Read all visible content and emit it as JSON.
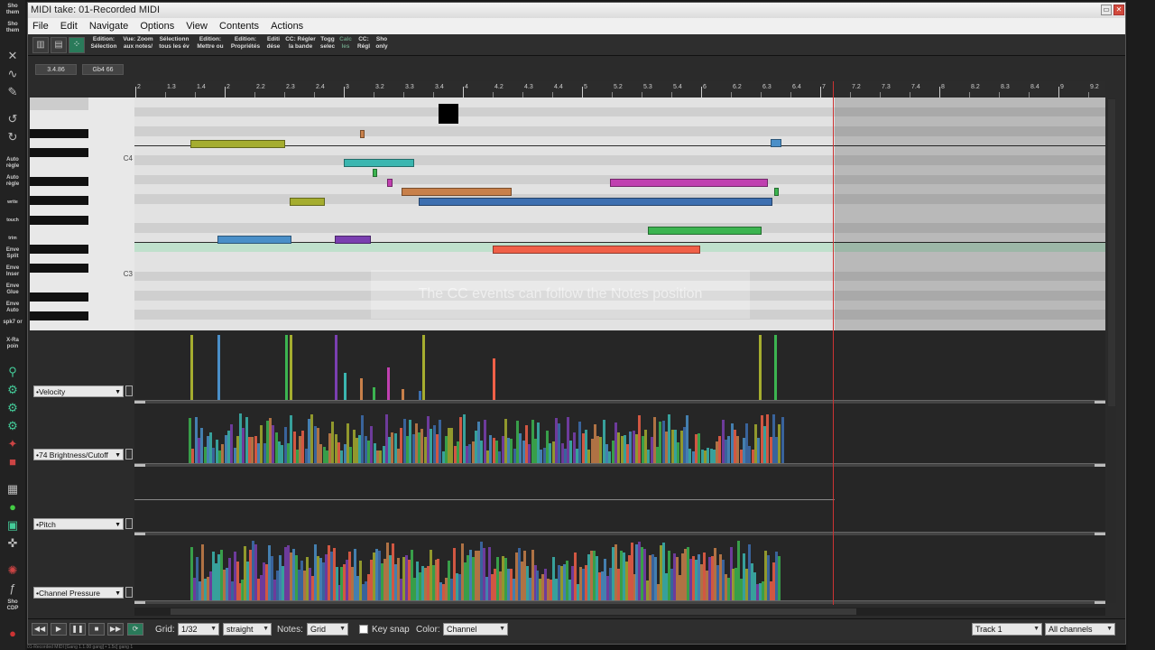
{
  "window": {
    "title": "MIDI take: 01-Recorded MIDI",
    "controls": [
      "▭",
      "✕"
    ]
  },
  "menu": [
    "File",
    "Edit",
    "Navigate",
    "Options",
    "View",
    "Contents",
    "Actions"
  ],
  "toolbar": {
    "buttons": [
      {
        "line1": "Edition:",
        "line2": "Sélection"
      },
      {
        "line1": "Vue: Zoom",
        "line2": "aux notes/"
      },
      {
        "line1": "Sélectionn",
        "line2": "tous les év"
      },
      {
        "line1": "Edition:",
        "line2": "Mettre ou"
      },
      {
        "line1": "Edition:",
        "line2": "Propriétés"
      },
      {
        "line1": "Editi",
        "line2": "dése"
      },
      {
        "line1": "CC: Régler",
        "line2": "la bande"
      },
      {
        "line1": "Togg",
        "line2": "selec"
      },
      {
        "line1": "Calc",
        "line2": "les"
      },
      {
        "line1": "CC:",
        "line2": "Régl"
      },
      {
        "line1": "Sho",
        "line2": "only"
      }
    ]
  },
  "position": {
    "time": "3.4.86",
    "note": "Gb4 66"
  },
  "ruler": {
    "labels": [
      "2",
      "1.3",
      "1.4",
      "2",
      "2.2",
      "2.3",
      "2.4",
      "3",
      "3.2",
      "3.3",
      "3.4",
      "4",
      "4.2",
      "4.3",
      "4.4",
      "5",
      "5.2",
      "5.3",
      "5.4",
      "6",
      "6.2",
      "6.3",
      "6.4",
      "7",
      "7.2",
      "7.3",
      "7.4",
      "8",
      "8.2",
      "8.3",
      "8.4",
      "9",
      "9.2"
    ]
  },
  "keys": {
    "c4": "C4",
    "c3": "C3"
  },
  "overlay": "The CC events can follow the Notes position",
  "lanes": {
    "velocity": "•Velocity",
    "brightness": "•74 Brightness/Cutoff",
    "pitch": "•Pitch",
    "pressure": "•Channel Pressure"
  },
  "left_strip": [
    "Sho them",
    "Sho them",
    "Auto règle",
    "Auto règle",
    "Enve Split",
    "Enve Inser",
    "Enve Glue",
    "Enve Auto",
    "spk7 or",
    "X-Ra poin",
    "Sho CDP"
  ],
  "left_strip_small": [
    "write",
    "touch",
    "trim"
  ],
  "status": {
    "grid_label": "Grid:",
    "grid_value": "1/32",
    "grid_type": "straight",
    "notes_label": "Notes:",
    "notes_value": "Grid",
    "keysnap_label": "Key snap",
    "color_label": "Color:",
    "color_value": "Channel",
    "track_value": "Track 1",
    "channels_value": "All channels"
  },
  "bottom_text": "01-Recorded MIDI [Gang 1.1.00 gang] • 1.5c] gang 1",
  "colors": {
    "accent": "#2a7a5a",
    "playhead": "#cc3333",
    "note_olive": "#a5ad2f",
    "note_teal": "#3bb6b0",
    "note_blue": "#3d6fb0",
    "note_purple": "#7a3fb0",
    "note_orange": "#c8804a",
    "note_magenta": "#c040b0",
    "note_green": "#3cb450",
    "note_red": "#f06048",
    "note_sky": "#4a8fc8"
  },
  "notes": [
    {
      "name": "note-olive-1",
      "color": "#a5ad2f"
    },
    {
      "name": "note-orange-small",
      "color": "#c8804a"
    },
    {
      "name": "note-teal-1",
      "color": "#3bb6b0"
    },
    {
      "name": "note-green-small",
      "color": "#3cb450"
    },
    {
      "name": "note-magenta-small",
      "color": "#c040b0"
    },
    {
      "name": "note-orange-long",
      "color": "#c8804a"
    },
    {
      "name": "note-olive-2",
      "color": "#a5ad2f"
    },
    {
      "name": "note-blue-long",
      "color": "#3d6fb0"
    },
    {
      "name": "note-magenta-long",
      "color": "#c040b0"
    },
    {
      "name": "note-sky-small",
      "color": "#4a8fc8"
    },
    {
      "name": "note-green-end",
      "color": "#3cb450"
    },
    {
      "name": "note-sky-1",
      "color": "#4a8fc8"
    },
    {
      "name": "note-purple-1",
      "color": "#7a3fb0"
    },
    {
      "name": "note-green-long",
      "color": "#3cb450"
    },
    {
      "name": "note-red-long",
      "color": "#f06048"
    }
  ]
}
